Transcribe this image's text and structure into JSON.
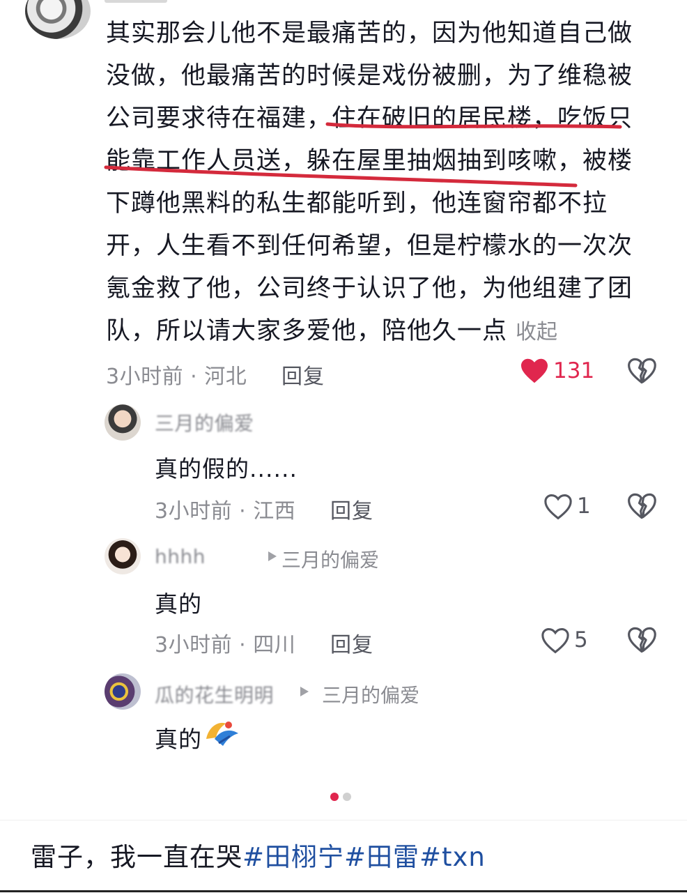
{
  "comment": {
    "text": "其实那会儿他不是最痛苦的，因为他知道自己做没做，他最痛苦的时候是戏份被删，为了维稳被公司要求待在福建，住在破旧的居民楼，吃饭只能靠工作人员送，躲在屋里抽烟抽到咳嗽，被楼下蹲他黑料的私生都能听到，他连窗帘都不拉开，人生看不到任何希望，但是柠檬水的一次次氪金救了他，公司终于认识了他，为他组建了团队，所以请大家多爱他，陪他久一点",
    "collapse_label": "收起",
    "meta": "3小时前 · 河北",
    "reply_label": "回复",
    "likes": "131",
    "colors": {
      "liked": "#e0264e",
      "highlight_pen": "#d42a3c"
    }
  },
  "replies": [
    {
      "username": "三月的偏爱",
      "reply_to": "",
      "text": "真的假的......",
      "meta": "3小时前 · 江西",
      "reply_label": "回复",
      "likes": "1"
    },
    {
      "username": "hhhh",
      "reply_to": "三月的偏爱",
      "text": "真的",
      "meta": "3小时前 · 四川",
      "reply_label": "回复",
      "likes": "5"
    },
    {
      "username": "瓜的花生明明",
      "reply_to": "三月的偏爱",
      "text": "真的",
      "meta": "",
      "reply_label": "",
      "likes": ""
    }
  ],
  "pager": {
    "current": 1,
    "total": 2,
    "colors": {
      "active": "#e0264e",
      "inactive": "#d0d0d0"
    }
  },
  "caption": {
    "text": "雷子，我一直在哭",
    "tags": [
      "#田栩宁",
      "#田雷",
      "#txn"
    ],
    "tag_color": "#1f4fa0"
  },
  "icons": [
    "heart-filled-icon",
    "heart-outline-icon",
    "broken-heart-icon",
    "play-triangle-icon",
    "crying-emoji-icon"
  ]
}
